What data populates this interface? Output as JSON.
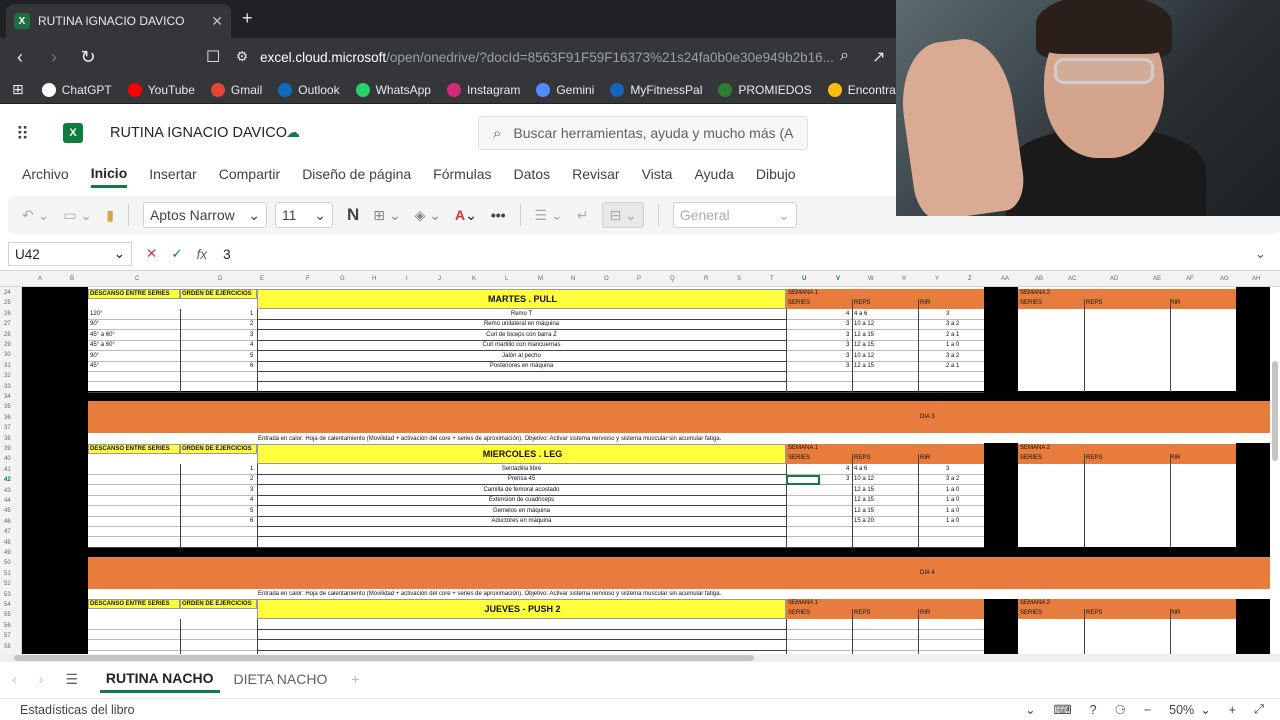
{
  "browser": {
    "tab_title": "RUTINA IGNACIO DAVICO",
    "url_site": "excel.cloud.microsoft",
    "url_rest": "/open/onedrive/?docId=8563F91F59F16373%21s24fa0b0e30e949b2b16...",
    "bookmarks": [
      {
        "label": "ChatGPT",
        "color": "#ffffff"
      },
      {
        "label": "YouTube",
        "color": "#ff0000"
      },
      {
        "label": "Gmail",
        "color": "#ea4335"
      },
      {
        "label": "Outlook",
        "color": "#0f6cbd"
      },
      {
        "label": "WhatsApp",
        "color": "#25d366"
      },
      {
        "label": "Instagram",
        "color": "#d62976"
      },
      {
        "label": "Gemini",
        "color": "#4f8cff"
      },
      {
        "label": "MyFitnessPal",
        "color": "#1565c0"
      },
      {
        "label": "PROMIEDOS",
        "color": "#2e7d32"
      },
      {
        "label": "Encontrar mi dis",
        "color": "#fbbc04"
      }
    ]
  },
  "excel": {
    "doc_name": "RUTINA IGNACIO DAVICO",
    "search_placeholder": "Buscar herramientas, ayuda y mucho más (A",
    "menu": [
      "Archivo",
      "Inicio",
      "Insertar",
      "Compartir",
      "Diseño de página",
      "Fórmulas",
      "Datos",
      "Revisar",
      "Vista",
      "Ayuda",
      "Dibujo"
    ],
    "font_name": "Aptos Narrow",
    "font_size": "11",
    "number_format": "General",
    "name_box": "U42",
    "formula_value": "3",
    "fx_label": "fx"
  },
  "grid": {
    "columns": [
      "A",
      "B",
      "C",
      "D",
      "E",
      "F",
      "G",
      "H",
      "I",
      "J",
      "K",
      "L",
      "M",
      "N",
      "O",
      "P",
      "Q",
      "R",
      "S",
      "T",
      "U",
      "V",
      "W",
      "X",
      "Y",
      "Z",
      "AA",
      "AB",
      "AC",
      "AD",
      "AE",
      "AF",
      "AG",
      "AH"
    ],
    "rows": [
      "24",
      "25",
      "26",
      "27",
      "28",
      "29",
      "30",
      "31",
      "32",
      "33",
      "34",
      "35",
      "36",
      "37",
      "38",
      "39",
      "40",
      "41",
      "42",
      "43",
      "44",
      "45",
      "46",
      "47",
      "48",
      "49",
      "50",
      "51",
      "52",
      "53",
      "54",
      "55",
      "56",
      "57",
      "58"
    ],
    "descanso_label": "DESCANSO ENTRE SERIES",
    "orden_label": "ORDEN DE EJERCICIOS",
    "semana1": "SEMANA 1",
    "semana2": "SEMANA 2",
    "series_h": "SERIES",
    "reps_h": "REPS",
    "rir_h": "RIR",
    "warmup": "Entrada en calor: Hoja de calentamiento (Movilidad + activación del core + series de aproximación). Objetivo: Activar sistema nervioso y sistema muscular sin acumular fatiga.",
    "dia3": "DIA 3",
    "dia4": "DIA 4",
    "block1": {
      "title": "MARTES . PULL",
      "rests": [
        "120°",
        "90°",
        "45° a 60°",
        "45° a 60°",
        "90°",
        "45°"
      ],
      "order": [
        "1",
        "2",
        "3",
        "4",
        "5",
        "6"
      ],
      "exercises": [
        "Remo T",
        "Remo unilateral en máquina",
        "Curl de biceps con barra Z",
        "Curl martillo con mancuernas",
        "Jalón al pecho",
        "Posteriores en máquina"
      ],
      "series": [
        "4",
        "3",
        "3",
        "3",
        "3",
        "3"
      ],
      "reps": [
        "4 a 6",
        "10 a 12",
        "12 a 15",
        "12 a 15",
        "10 a 12",
        "12 a 15"
      ],
      "rir": [
        "3",
        "3 a 2",
        "2 a 1",
        "1 a 0",
        "3 a 2",
        "2 a 1"
      ]
    },
    "block2": {
      "title": "MIERCOLES . LEG",
      "order": [
        "1",
        "2",
        "3",
        "4",
        "5",
        "6"
      ],
      "exercises": [
        "Sentadilla libre",
        "Prensa 45",
        "Camilla de femoral acostado",
        "Extension de cuadriceps",
        "Gemelos en máquina",
        "Aductores en máquina"
      ],
      "series": [
        "4",
        "3",
        "",
        "",
        "",
        ""
      ],
      "reps": [
        "4 a 6",
        "10 a 12",
        "12 a 15",
        "12 a 15",
        "12 a 15",
        "15 a 20"
      ],
      "rir": [
        "3",
        "3 a 2",
        "1 a 0",
        "1 a 0",
        "1 a 0",
        "1 a 0"
      ]
    },
    "block3": {
      "title": "JUEVES - PUSH 2"
    }
  },
  "sheets": [
    "RUTINA NACHO",
    "DIETA NACHO"
  ],
  "status": {
    "left": "Estadísticas del libro",
    "zoom": "50%"
  }
}
